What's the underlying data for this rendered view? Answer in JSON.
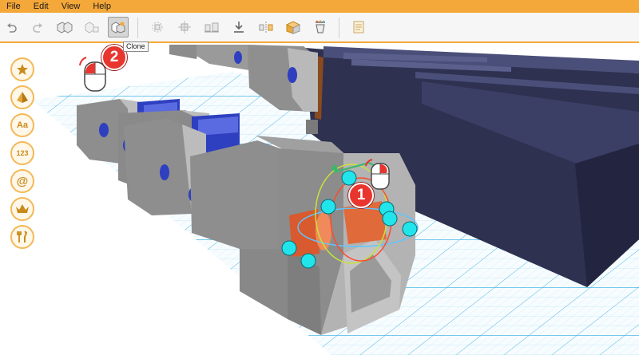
{
  "menu": {
    "items": [
      "File",
      "Edit",
      "View",
      "Help"
    ]
  },
  "toolbar": {
    "buttons": [
      {
        "name": "undo-icon"
      },
      {
        "name": "redo-icon"
      },
      {
        "name": "group-icon"
      },
      {
        "name": "ungroup-icon"
      },
      {
        "name": "clone-icon"
      },
      {
        "name": "transform-icon"
      },
      {
        "name": "snap-icon"
      },
      {
        "name": "align-icon"
      },
      {
        "name": "drop-icon"
      },
      {
        "name": "mirror-icon"
      },
      {
        "name": "material-icon"
      },
      {
        "name": "paint-bucket-icon"
      },
      {
        "name": "notes-icon"
      }
    ],
    "tooltip": "Clone"
  },
  "sidebar": {
    "items": [
      {
        "name": "favorites",
        "icon": "star-icon"
      },
      {
        "name": "shapes",
        "icon": "pyramid-icon"
      },
      {
        "name": "text",
        "icon": "text-icon",
        "label": "Aa"
      },
      {
        "name": "numbers",
        "icon": "numbers-icon",
        "label": "123"
      },
      {
        "name": "symbols",
        "icon": "at-icon",
        "label": "@"
      },
      {
        "name": "premium",
        "icon": "crown-icon"
      },
      {
        "name": "tools",
        "icon": "tools-icon"
      }
    ]
  },
  "steps": {
    "step1": "1",
    "step2": "2"
  },
  "colors": {
    "accent": "#f5a83a",
    "block_gray": "#8e8e8e",
    "block_blue": "#2e3fc0",
    "dark_navy": "#2e3150",
    "grid_blue": "#4fb9e6",
    "handle_cyan": "#22e5ec",
    "selected_orange": "#e06a3a",
    "badge_red": "#e8352d"
  }
}
